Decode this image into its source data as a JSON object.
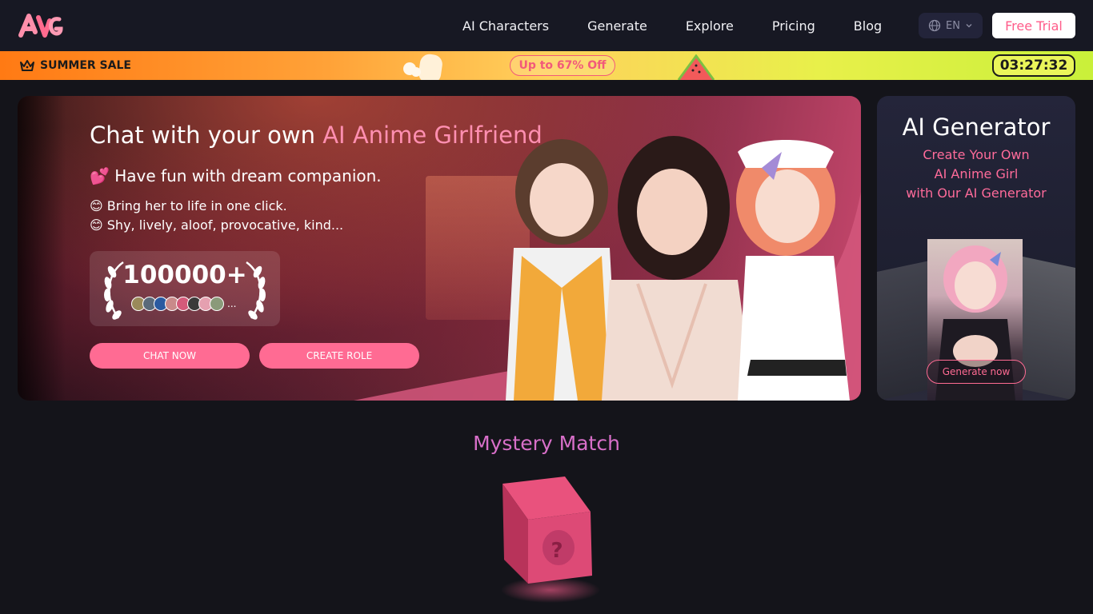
{
  "nav": {
    "logo_icon": "ag-logo-icon",
    "links": [
      "AI Characters",
      "Generate",
      "Explore",
      "Pricing",
      "Blog"
    ],
    "language": "EN",
    "trial_label": "Free Trial"
  },
  "sale": {
    "label": "SUMMER SALE",
    "offer": "Up to 67% Off",
    "timer": "03:27:32"
  },
  "hero": {
    "title_prefix": "Chat with your own ",
    "title_accent": "AI Anime Girlfriend",
    "subtitle": "💕 Have fun with dream companion.",
    "line1": "😊 Bring her to life in one click.",
    "line2": "😊 Shy, lively, aloof, provocative, kind...",
    "stat_value": "100000+",
    "stat_more": "...",
    "chat_button": "CHAT NOW",
    "create_button": "CREATE ROLE"
  },
  "generator": {
    "title": "AI Generator",
    "sub1": "Create Your Own",
    "sub2": "AI Anime Girl",
    "sub3": "with Our AI Generator",
    "button": "Generate now"
  },
  "mystery": {
    "title": "Mystery Match",
    "cube_symbol": "?"
  },
  "colors": {
    "accent": "#ff6b93",
    "nav_bg": "#171823",
    "page_bg": "#14141a"
  }
}
